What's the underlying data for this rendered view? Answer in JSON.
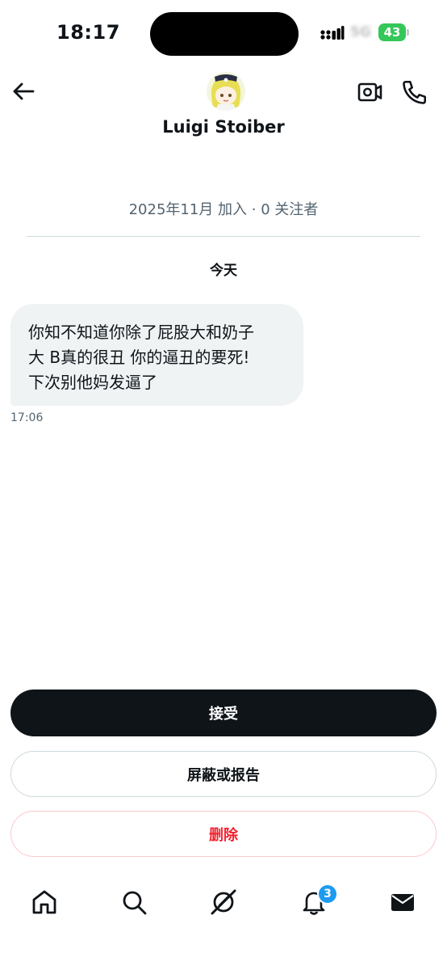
{
  "status_bar": {
    "time": "18:17",
    "network": "5G",
    "battery": "43"
  },
  "header": {
    "contact_name": "Luigi Stoiber",
    "back_icon": "arrow-left-icon",
    "video_icon": "video-camera-icon",
    "phone_icon": "phone-icon"
  },
  "profile_meta": "2025年11月 加入 · 0 关注者",
  "conversation": {
    "day_label": "今天",
    "messages": [
      {
        "text": "你知不知道你除了屁股大和奶子\n大 B真的很丑 你的逼丑的要死!\n下次别他妈发逼了",
        "time": "17:06"
      }
    ]
  },
  "actions": {
    "accept": "接受",
    "block_or_report": "屏蔽或报告",
    "delete": "删除"
  },
  "bottom_nav": {
    "items": [
      "home-icon",
      "search-icon",
      "grok-icon",
      "notifications-icon",
      "messages-icon"
    ],
    "notification_badge": "3"
  },
  "colors": {
    "text_primary": "#0f1419",
    "text_secondary": "#536471",
    "bubble_bg": "#eff3f4",
    "delete_red": "#f4212e",
    "badge_blue": "#1d9bf0",
    "battery_green": "#34c759"
  }
}
